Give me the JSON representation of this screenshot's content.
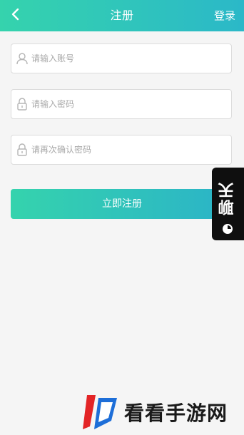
{
  "header": {
    "title": "注册",
    "login_label": "登录",
    "back_icon": "chevron-left-icon",
    "background": "#2fc5b9"
  },
  "form": {
    "account": {
      "placeholder": "请输入账号",
      "value": "",
      "icon": "user-icon"
    },
    "password": {
      "placeholder": "请输入密码",
      "value": "",
      "icon": "lock-icon"
    },
    "confirm_password": {
      "placeholder": "请再次确认密码",
      "value": "",
      "icon": "lock-icon"
    },
    "submit_label": "立即注册"
  },
  "chat_tab": {
    "label": "聊天",
    "icon": "chat-dot-icon"
  },
  "watermark": {
    "text": "看看手游网",
    "logo_icon": "watermark-logo-icon"
  },
  "colors": {
    "accent_start": "#35d3ad",
    "accent_end": "#2bb8c8",
    "background": "#f5f5f5"
  }
}
